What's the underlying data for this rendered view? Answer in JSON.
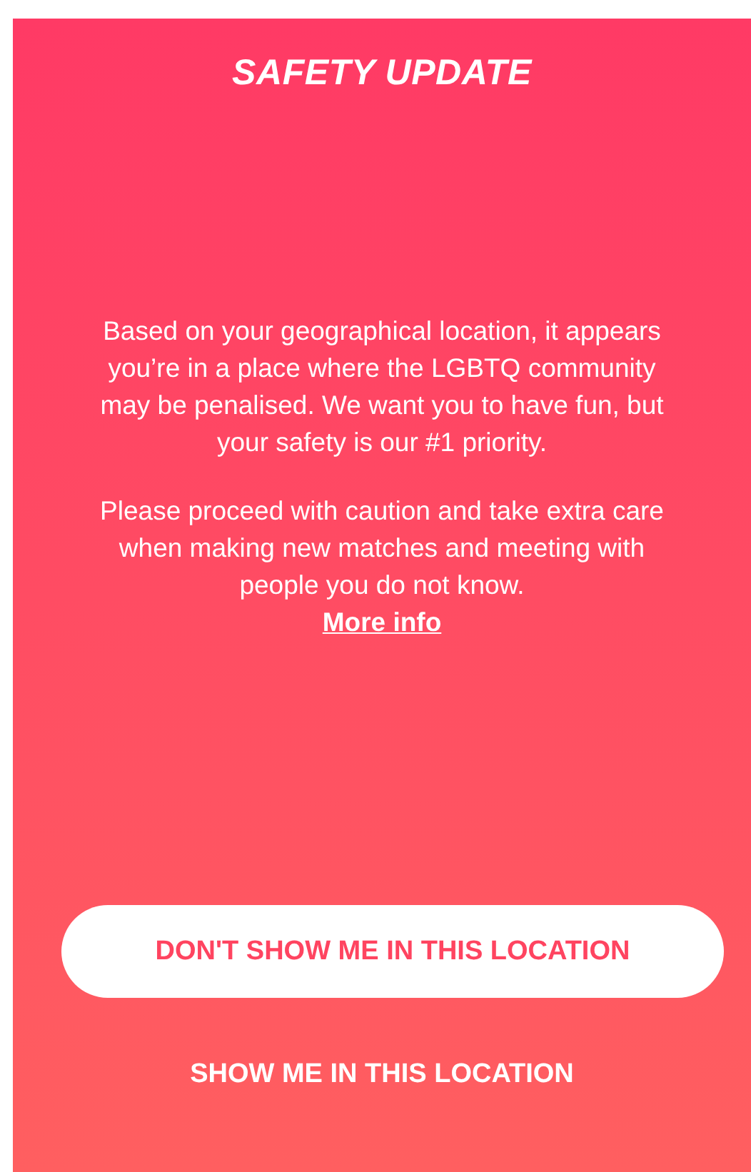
{
  "title": "SAFETY UPDATE",
  "paragraphs": [
    "Based on your geographical location, it appears you’re in a place where the LGBTQ community may be penalised. We want you to have fun, but your safety is our #1 priority.",
    "Please proceed with caution and take extra care when making new matches and meeting with people you do not know."
  ],
  "more_info_link": "More info",
  "buttons": [
    {
      "label": "DON'T SHOW ME IN THIS LOCATION",
      "kind": "primary"
    },
    {
      "label": "SHOW ME IN THIS LOCATION",
      "kind": "text"
    }
  ]
}
